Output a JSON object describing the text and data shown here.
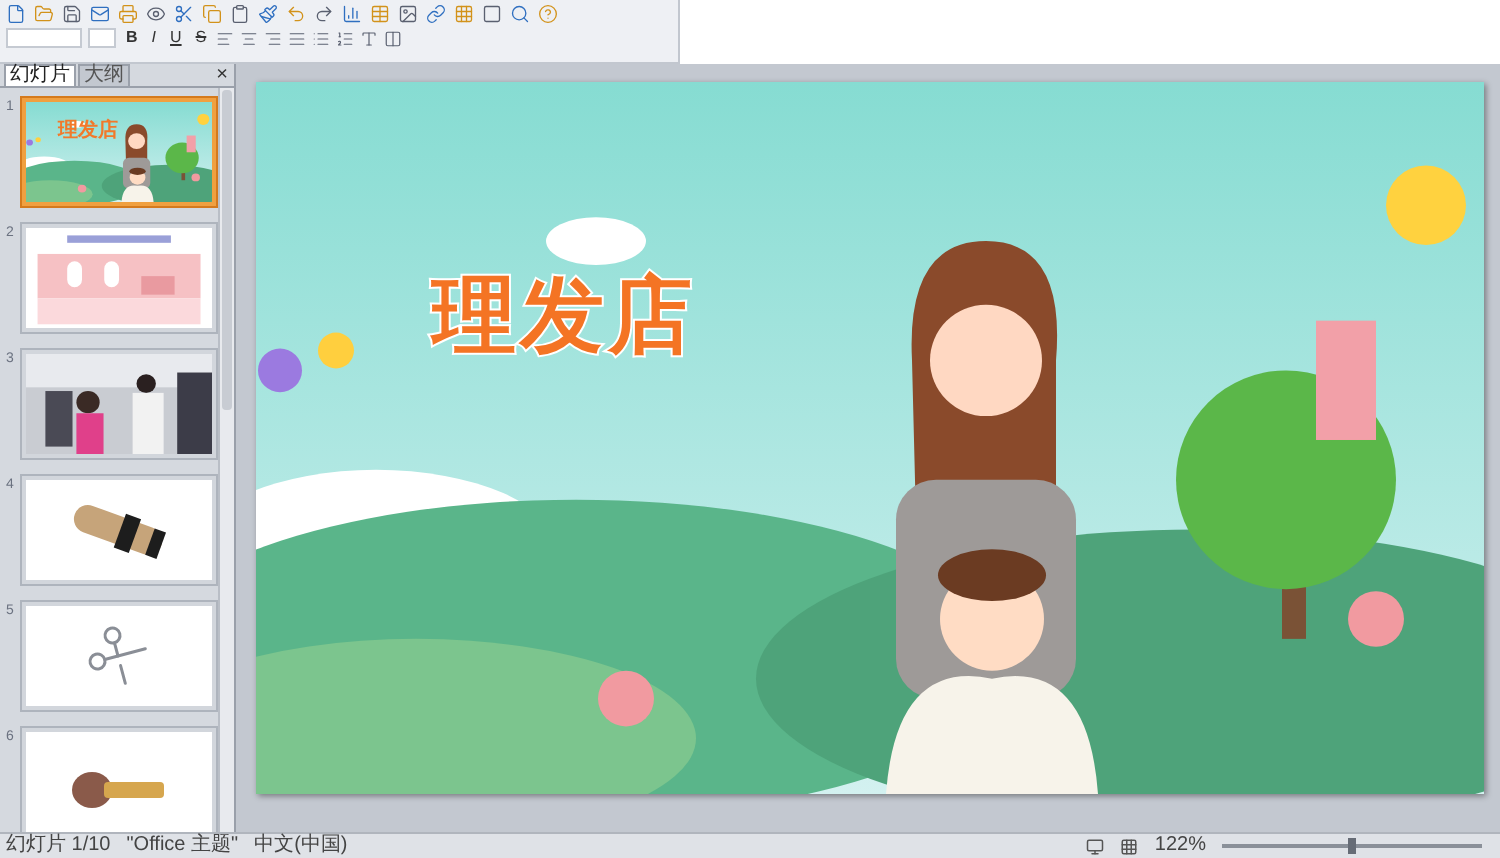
{
  "toolbar": {
    "format_buttons": [
      "B",
      "I",
      "U",
      "S"
    ]
  },
  "panel": {
    "tabs": [
      {
        "label": "幻灯片",
        "selected": true
      },
      {
        "label": "大纲",
        "selected": false
      }
    ],
    "close": "×"
  },
  "slides": [
    {
      "number": "1",
      "selected": true,
      "kind": "title",
      "title": "理发店"
    },
    {
      "number": "2",
      "selected": false,
      "kind": "room"
    },
    {
      "number": "3",
      "selected": false
    },
    {
      "number": "4",
      "selected": false,
      "kind": "clipper"
    },
    {
      "number": "5",
      "selected": false,
      "kind": "scissors"
    },
    {
      "number": "6",
      "selected": false,
      "kind": "brush"
    }
  ],
  "slide": {
    "title": "理发店"
  },
  "status_bar": {
    "slide": "幻灯片 1/10",
    "theme": "\"Office 主题\"",
    "language": "中文(中国)",
    "zoom": "122%",
    "zoom_slider": {
      "level": 0.5
    }
  }
}
